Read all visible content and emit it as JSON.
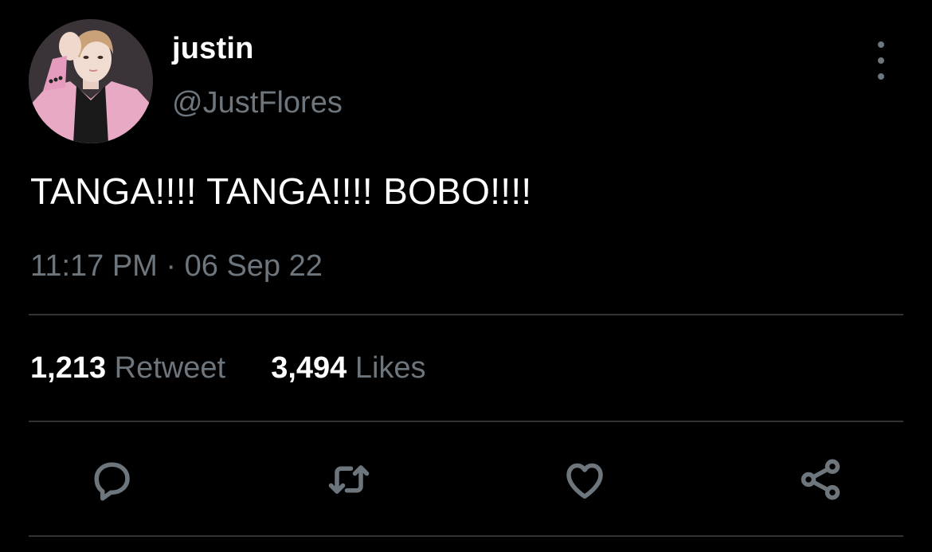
{
  "tweet": {
    "author": {
      "display_name": "justin",
      "handle": "@JustFlores",
      "avatar": "profile-photo"
    },
    "text": "TANGA!!!! TANGA!!!! BOBO!!!!",
    "time": "11:17 PM",
    "separator": "·",
    "date": "06 Sep 22",
    "stats": {
      "retweets_count": "1,213",
      "retweets_label": "Retweet",
      "likes_count": "3,494",
      "likes_label": "Likes"
    },
    "actions": [
      {
        "icon": "reply-icon"
      },
      {
        "icon": "retweet-icon"
      },
      {
        "icon": "like-icon"
      },
      {
        "icon": "share-icon"
      }
    ],
    "more_icon": "more-vertical-icon"
  },
  "colors": {
    "background": "#000000",
    "primary_text": "#ffffff",
    "secondary_text": "#6e767d",
    "divider": "#2f3336"
  }
}
